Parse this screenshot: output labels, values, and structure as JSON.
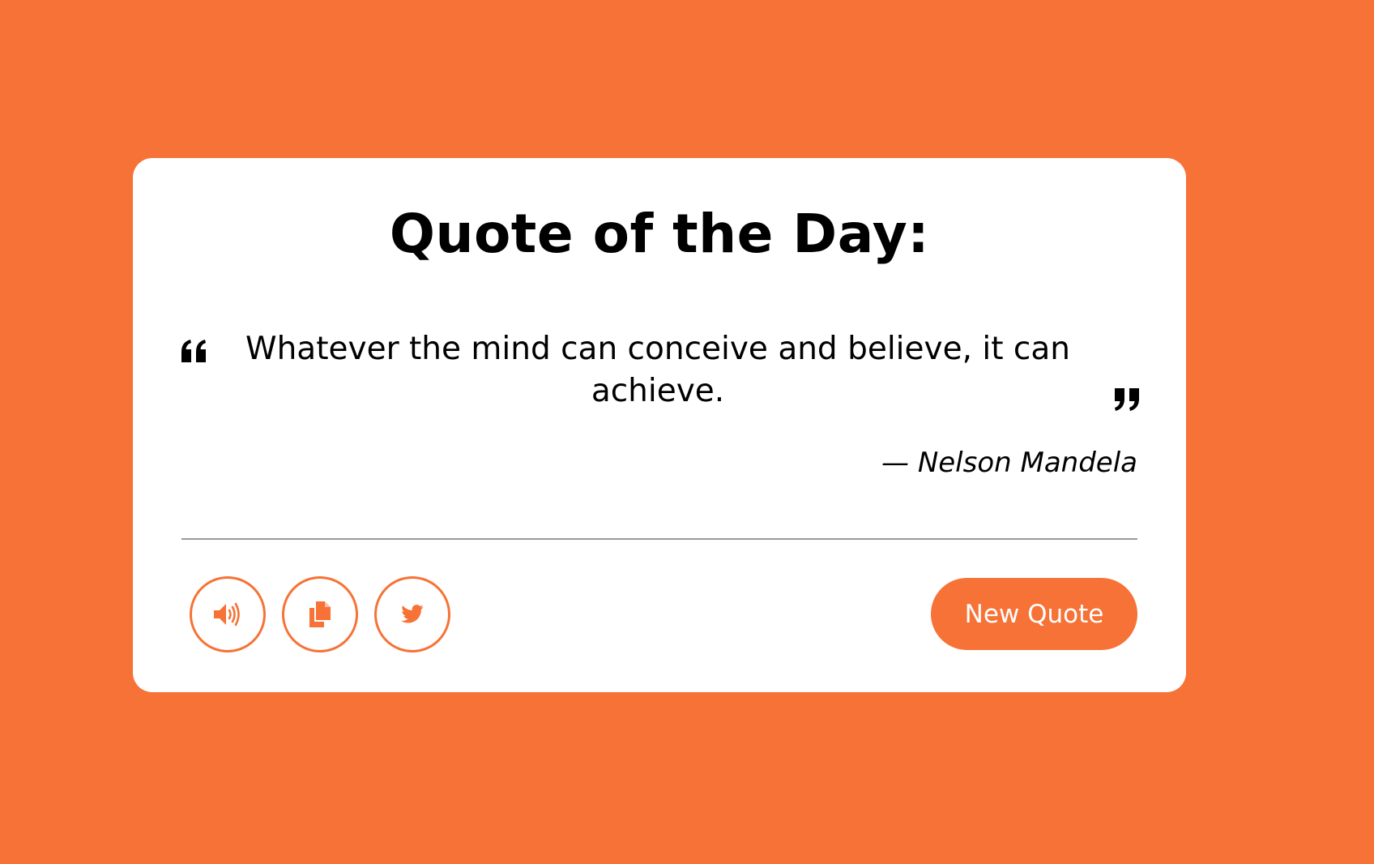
{
  "colors": {
    "background": "#F77236",
    "card": "#FFFFFF",
    "accent": "#F77236",
    "text": "#000000",
    "divider": "#9A9A9A"
  },
  "header": {
    "title": "Quote of the Day:"
  },
  "quote": {
    "text": "Whatever the mind can conceive and believe, it can achieve.",
    "author": "— Nelson Mandela",
    "open_icon": "open-quote-icon",
    "close_icon": "close-quote-icon"
  },
  "actions": {
    "speak_icon": "speaker-icon",
    "copy_icon": "copy-icon",
    "tweet_icon": "twitter-icon",
    "new_quote_label": "New Quote"
  }
}
